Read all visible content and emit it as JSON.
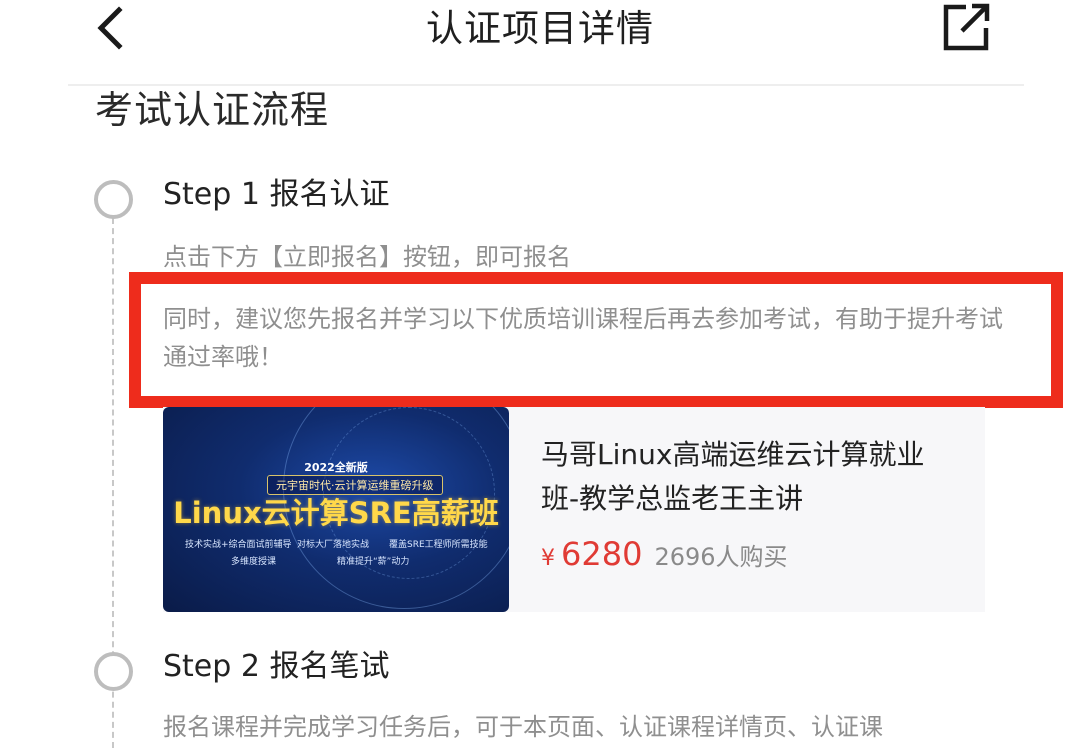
{
  "header": {
    "title": "认证项目详情",
    "back_icon": "chevron-left-icon",
    "share_icon": "share-icon"
  },
  "section": {
    "title": "考试认证流程"
  },
  "steps": [
    {
      "title": "Step 1 报名认证",
      "description": "点击下方【立即报名】按钮，即可报名",
      "recommendation": "同时，建议您先报名并学习以下优质培训课程后再去参加考试，有助于提升考试通过率哦！",
      "course": {
        "thumbnail": {
          "edition": "2022全新版",
          "subtitle": "元宇宙时代·云计算运维重磅升级",
          "title": "Linux云计算SRE高薪班",
          "features": [
            "技术实战+综合面试前辅导",
            "对标大厂落地实战",
            "覆盖SRE工程师所需技能",
            "多维度授课",
            "精准提升“薪”动力"
          ]
        },
        "name": "马哥Linux高端运维云计算就业班-教学总监老王主讲",
        "price_symbol": "¥",
        "price": "6280",
        "buyers": "2696人购买"
      }
    },
    {
      "title": "Step 2 报名笔试",
      "description": "报名课程并完成学习任务后，可于本页面、认证课程详情页、认证课"
    }
  ],
  "colors": {
    "highlight_border": "#ee2c1c",
    "price": "#e03b35",
    "muted_text": "#8f8f8f"
  }
}
